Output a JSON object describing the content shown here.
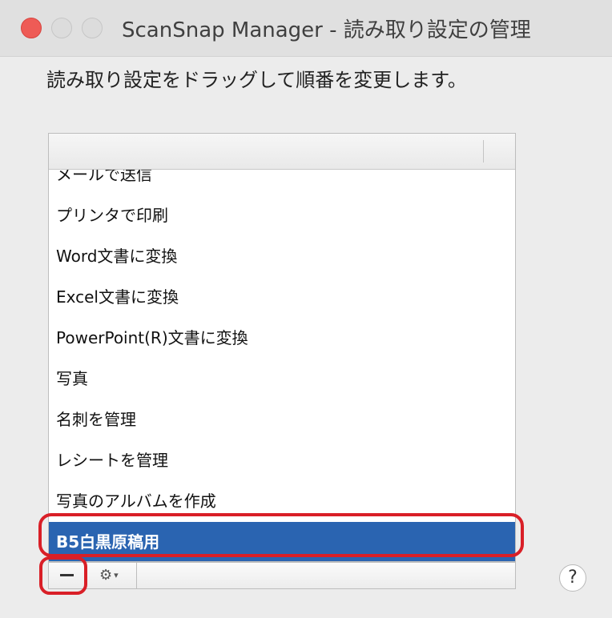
{
  "window": {
    "title": "ScanSnap Manager - 読み取り設定の管理"
  },
  "instruction": "読み取り設定をドラッグして順番を変更します。",
  "profiles": [
    {
      "label": "メールで送信",
      "selected": false
    },
    {
      "label": "プリンタで印刷",
      "selected": false
    },
    {
      "label": "Word文書に変換",
      "selected": false
    },
    {
      "label": "Excel文書に変換",
      "selected": false
    },
    {
      "label": "PowerPoint(R)文書に変換",
      "selected": false
    },
    {
      "label": "写真",
      "selected": false
    },
    {
      "label": "名刺を管理",
      "selected": false
    },
    {
      "label": "レシートを管理",
      "selected": false
    },
    {
      "label": "写真のアルバムを作成",
      "selected": false
    },
    {
      "label": "B5白黒原稿用",
      "selected": true
    }
  ],
  "toolbar": {
    "remove_icon": "minus-icon",
    "action_icon": "gear-icon"
  },
  "help": {
    "label": "?"
  },
  "colors": {
    "selection": "#2a64b1",
    "annotation": "#d91f27",
    "close": "#ee5b56"
  }
}
